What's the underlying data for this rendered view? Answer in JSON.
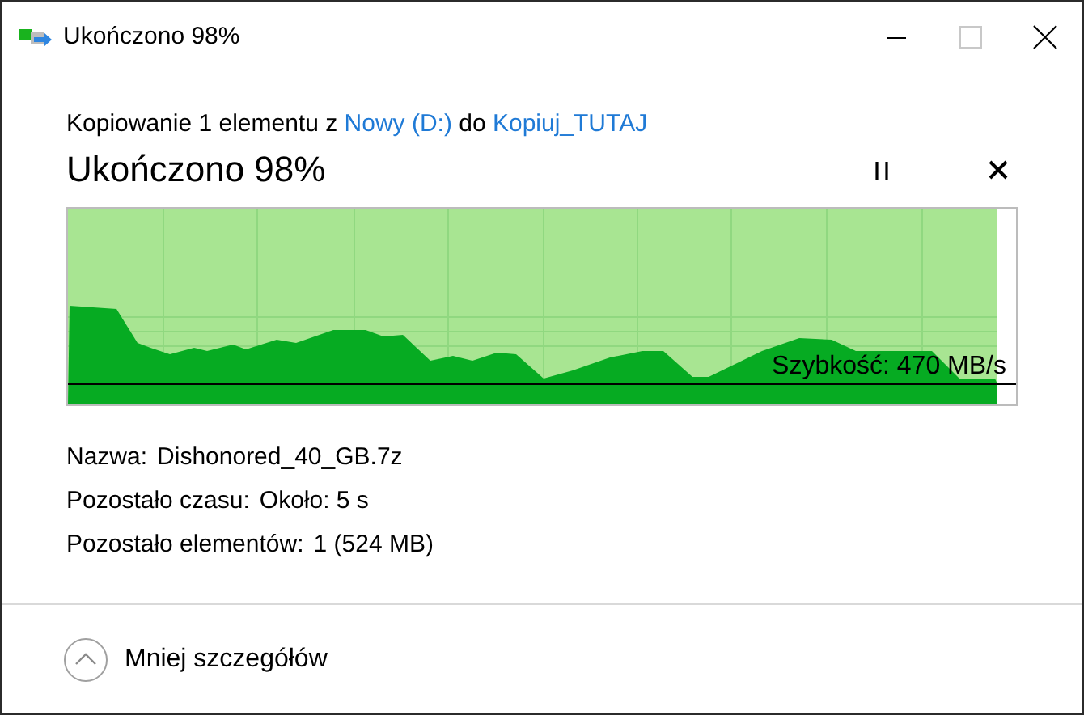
{
  "window": {
    "title": "Ukończono 98%"
  },
  "copy_line": [
    {
      "kind": "text",
      "text": "Kopiowanie 1 elementu z "
    },
    {
      "kind": "link",
      "text": "Nowy (D:)"
    },
    {
      "kind": "text",
      "text": " do "
    },
    {
      "kind": "link",
      "text": "Kopiuj_TUTAJ"
    }
  ],
  "heading": "Ukończono 98%",
  "progress": {
    "level": 0.98,
    "speed": "Szybkość: 470 MB/s"
  },
  "details": [
    {
      "label": "Nazwa:",
      "value": "Dishonored_40_GB.7z"
    },
    {
      "label": "Pozostało czasu:",
      "value": "Około: 5 s"
    },
    {
      "label": "Pozostało elementów:",
      "value": "1 (524 MB)"
    }
  ],
  "footer": {
    "toggle": "Mniej szczegółów",
    "expanded": true
  }
}
